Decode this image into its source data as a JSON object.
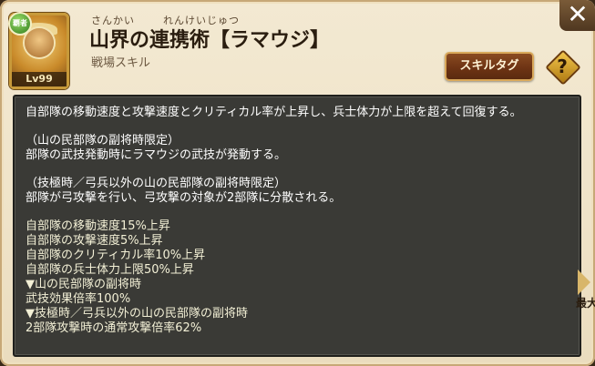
{
  "skill": {
    "ruby_left": "さんかい",
    "ruby_right": "れんけいじゅつ",
    "title": "山界の連携術【ラマウジ】",
    "category": "戦場スキル",
    "level": "Lv99",
    "badge": "覇者"
  },
  "buttons": {
    "skill_tag": "スキルタグ",
    "help": "?",
    "close": "✕",
    "side": "最大"
  },
  "description": {
    "main": "自部隊の移動速度と攻撃速度とクリティカル率が上昇し、兵士体力が上限を超えて回復する。",
    "cond1_header": "（山の民部隊の副将時限定）",
    "cond1_text": "部隊の武技発動時にラマウジの武技が発動する。",
    "cond2_header": "（技極時／弓兵以外の山の民部隊の副将時限定）",
    "cond2_text": "部隊が弓攻撃を行い、弓攻撃の対象が2部隊に分散される。",
    "stats": [
      "自部隊の移動速度15%上昇",
      "自部隊の攻撃速度5%上昇",
      "自部隊のクリティカル率10%上昇",
      "自部隊の兵士体力上限50%上昇",
      "▼山の民部隊の副将時",
      "武技効果倍率100%",
      "▼技極時／弓兵以外の山の民部隊の副将時",
      "2部隊攻撃時の通常攻撃倍率62%"
    ]
  },
  "colors": {
    "panel_bg": "#efe3c8",
    "desc_bg": "#3a3a36",
    "button_brown": "#6e3414",
    "accent_gold": "#d9a85a"
  }
}
